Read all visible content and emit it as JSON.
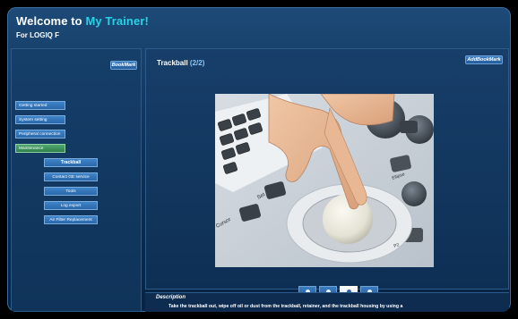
{
  "header": {
    "title_prefix": "Welcome to",
    "title_accent": "My Trainer!",
    "subtitle": "For LOGIQ F"
  },
  "left": {
    "bookmark_label": "BookMark",
    "nav_items": [
      {
        "label": "Getting started"
      },
      {
        "label": "System setting"
      },
      {
        "label": "Peripheral connection"
      },
      {
        "label": "Maintenance"
      }
    ],
    "sub_items": [
      {
        "label": "Trackball"
      },
      {
        "label": "Contact GE service"
      },
      {
        "label": "Tools"
      },
      {
        "label": "Log export"
      },
      {
        "label": "Air Filter Replacement"
      }
    ]
  },
  "main": {
    "section_title": "Trackball",
    "page_indicator": "(2/2)",
    "add_bookmark_label": "AddBookMark",
    "photo_keys": {
      "set": "Set",
      "cursor": "Cursor",
      "ellipse": "Ellipse",
      "p2": "P2"
    }
  },
  "description": {
    "title": "Description",
    "text": "Take the trackball out, wipe off oil or dust from the trackball, retainer, and the trackball housing by using a"
  }
}
